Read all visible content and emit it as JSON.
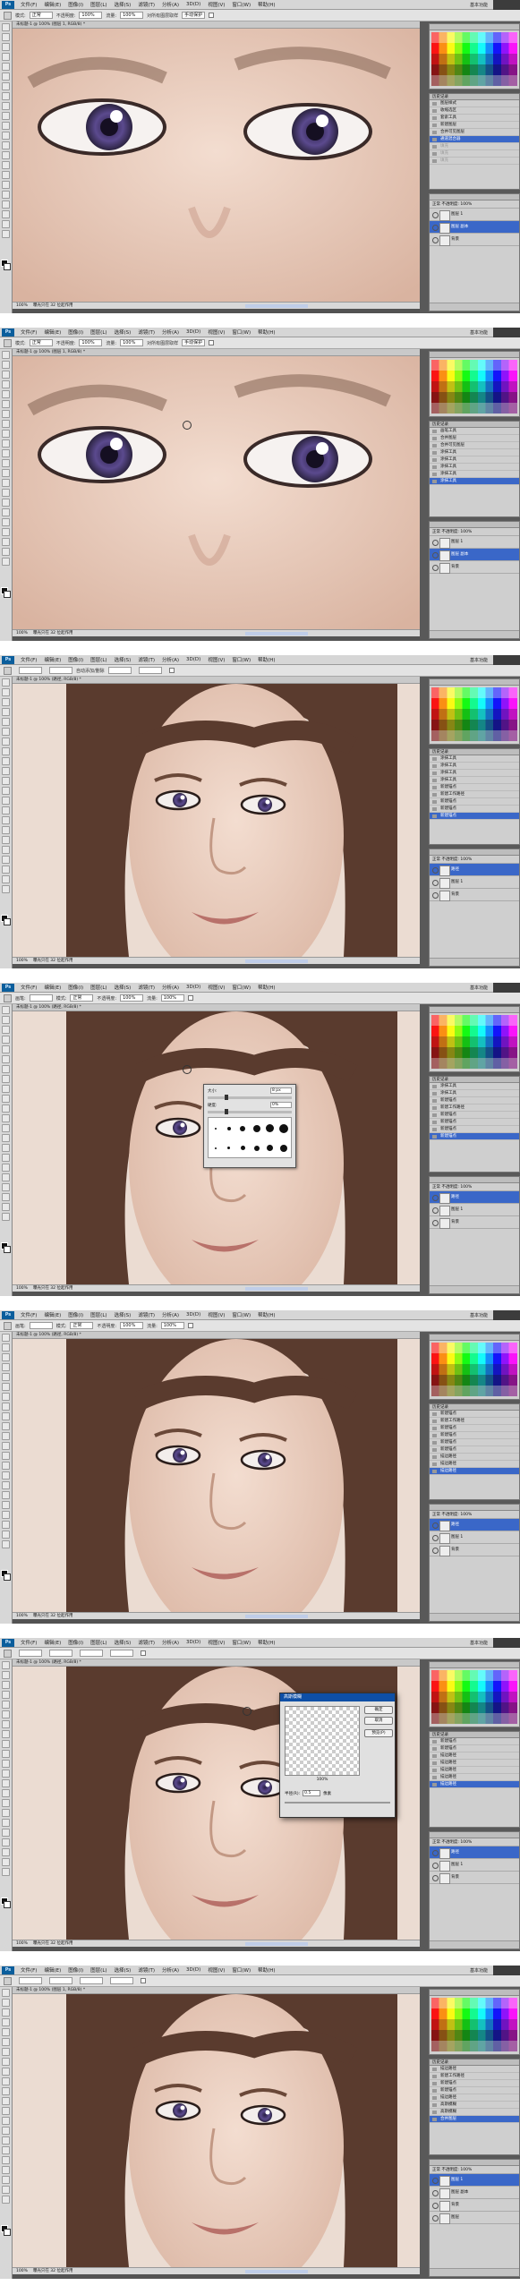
{
  "menu": {
    "app": "Ps",
    "items": [
      "文件(F)",
      "编辑(E)",
      "图像(I)",
      "图层(L)",
      "选择(S)",
      "滤镜(T)",
      "分析(A)",
      "3D(D)",
      "视图(V)",
      "窗口(W)",
      "帮助(H)"
    ],
    "workspace": "基本功能"
  },
  "frames": [
    {
      "tool": "画笔",
      "opts": [
        "模式:",
        "正常",
        "不透明度:",
        "100%",
        "流量:",
        "100%",
        "对所有图层取样",
        "手动保护"
      ],
      "doc": "未标题-1 @ 100% (图层 1, RGB/8) *",
      "status": [
        "100%",
        "曝光只在 32 位起作用"
      ],
      "history": [
        "历史记录",
        "图层样式",
        "收缩选区",
        "套索工具",
        "新建图层",
        "合并可见图层",
        "通道混合器",
        "填充",
        "填充",
        "填充"
      ],
      "hist_sel": 6,
      "layers": [
        "图层 1",
        "图层 副本",
        "背景"
      ],
      "layer_sel": 1,
      "layer_opts": "正常  不透明度: 100%"
    },
    {
      "tool": "画笔",
      "opts": [
        "模式:",
        "正常",
        "不透明度:",
        "100%",
        "流量:",
        "100%",
        "对所有图层取样",
        "手动保护"
      ],
      "doc": "未标题-1 @ 100% (图层 1, RGB/8) *",
      "status": [
        "100%",
        "曝光只在 32 位起作用"
      ],
      "history": [
        "历史记录",
        "画笔工具",
        "合并图层",
        "合并可见图层",
        "涂抹工具",
        "涂抹工具",
        "涂抹工具",
        "涂抹工具",
        "涂抹工具"
      ],
      "hist_sel": 8,
      "layers": [
        "图层 1",
        "图层 副本",
        "背景"
      ],
      "layer_sel": 1,
      "layer_opts": "正常  不透明度: 100%"
    },
    {
      "tool": "钢笔",
      "opts": [
        "",
        "",
        "",
        "",
        "自动添加/删除",
        "",
        "",
        "",
        ""
      ],
      "doc": "未标题-1 @ 100% (路径, RGB/8) *",
      "status": [
        "100%",
        "曝光只在 32 位起作用"
      ],
      "history": [
        "历史记录",
        "涂抹工具",
        "涂抹工具",
        "涂抹工具",
        "涂抹工具",
        "新建锚点",
        "新建工作路径",
        "新建锚点",
        "新建锚点",
        "新建锚点"
      ],
      "hist_sel": 9,
      "layers": [
        "路径",
        "图层 1",
        "背景"
      ],
      "layer_sel": 0,
      "layer_opts": "正常  不透明度: 100%"
    },
    {
      "tool": "画笔",
      "opts": [
        "画笔:",
        "",
        "模式:",
        "正常",
        "不透明度:",
        "100%",
        "流量:",
        "100%"
      ],
      "doc": "未标题-1 @ 100% (路径, RGB/8) *",
      "status": [
        "100%",
        "曝光只在 32 位起作用"
      ],
      "history": [
        "历史记录",
        "涂抹工具",
        "涂抹工具",
        "新建锚点",
        "新建工作路径",
        "新建锚点",
        "新建锚点",
        "新建锚点",
        "新建锚点"
      ],
      "hist_sel": 8,
      "layers": [
        "路径",
        "图层 1",
        "背景"
      ],
      "layer_sel": 0,
      "layer_opts": "正常  不透明度: 100%",
      "brush_popup": {
        "size_label": "大小:",
        "size_value": "8 px",
        "hardness_label": "硬度:",
        "hardness_value": "0%"
      }
    },
    {
      "tool": "画笔",
      "opts": [
        "画笔:",
        "",
        "模式:",
        "正常",
        "不透明度:",
        "100%",
        "流量:",
        "100%"
      ],
      "doc": "未标题-1 @ 100% (路径, RGB/8) *",
      "status": [
        "100%",
        "曝光只在 32 位起作用"
      ],
      "history": [
        "历史记录",
        "新建锚点",
        "新建工作路径",
        "新建锚点",
        "新建锚点",
        "新建锚点",
        "新建锚点",
        "描边路径",
        "描边路径",
        "描边路径"
      ],
      "hist_sel": 9,
      "layers": [
        "路径",
        "图层 1",
        "背景"
      ],
      "layer_sel": 0,
      "layer_opts": "正常  不透明度: 100%"
    },
    {
      "tool": "选区",
      "opts": [
        "",
        "",
        "",
        "",
        "",
        "",
        "",
        "",
        ""
      ],
      "doc": "未标题-1 @ 100% (路径, RGB/8) *",
      "status": [
        "100%",
        "曝光只在 32 位起作用"
      ],
      "history": [
        "历史记录",
        "新建锚点",
        "新建锚点",
        "描边路径",
        "描边路径",
        "描边路径",
        "描边路径",
        "描边路径"
      ],
      "hist_sel": 7,
      "layers": [
        "路径",
        "图层 1",
        "背景"
      ],
      "layer_sel": 0,
      "layer_opts": "正常  不透明度: 100%",
      "dialog": {
        "title": "高斯模糊",
        "ok": "确定",
        "cancel": "取消",
        "preview": "预览(P)",
        "zoom": "100%",
        "radius_label": "半径(R):",
        "radius_value": "0.5",
        "unit": "像素"
      }
    },
    {
      "tool": "选区",
      "opts": [
        "",
        "",
        "",
        "",
        "",
        "",
        "",
        "",
        ""
      ],
      "doc": "未标题-1 @ 100% (图层 1, RGB/8) *",
      "status": [
        "100%",
        "曝光只在 32 位起作用"
      ],
      "history": [
        "历史记录",
        "描边路径",
        "新建工作路径",
        "新建锚点",
        "新建锚点",
        "描边路径",
        "高斯模糊",
        "高斯模糊",
        "合并图层"
      ],
      "hist_sel": 8,
      "layers": [
        "图层 1",
        "图层 副本",
        "背景",
        "图层"
      ],
      "layer_sel": 0,
      "layer_opts": "正常  不透明度: 100%"
    }
  ]
}
